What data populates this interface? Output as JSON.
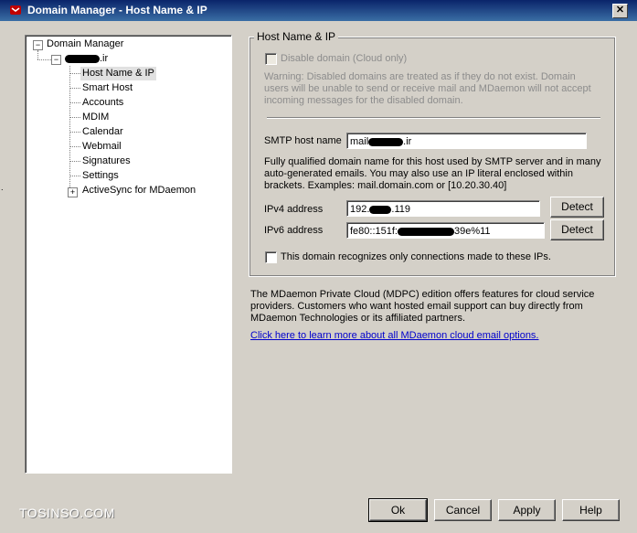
{
  "window": {
    "title": "Domain Manager - Host Name & IP",
    "close_label": "✕"
  },
  "tree": {
    "root": "Domain Manager",
    "domain_suffix": ".ir",
    "items": [
      "Host Name & IP",
      "Smart Host",
      "Accounts",
      "MDIM",
      "Calendar",
      "Webmail",
      "Signatures",
      "Settings",
      "ActiveSync for MDaemon"
    ],
    "selected": "Host Name & IP"
  },
  "host_group": {
    "legend": "Host Name & IP",
    "disable_label": "Disable domain (Cloud only)",
    "warning": "Warning:  Disabled domains are treated as if they do not exist.  Domain users will be unable to send or receive mail and MDaemon will not accept incoming messages for the disabled domain.",
    "smtp_label": "SMTP host name",
    "smtp_prefix": "mail",
    "smtp_suffix": ".ir",
    "fqdn_note": "Fully qualified domain name for this host used by SMTP server and in many auto-generated emails.  You may also use an IP literal enclosed within brackets.  Examples:  mail.domain.com or [10.20.30.40]",
    "ipv4_label": "IPv4 address",
    "ipv4_prefix": "192.",
    "ipv4_suffix": ".119",
    "ipv6_label": "IPv6 address",
    "ipv6_prefix": "fe80::151f:",
    "ipv6_suffix": "39e%11",
    "detect_label": "Detect",
    "recognize_label": "This domain recognizes only connections made to these IPs."
  },
  "cloud": {
    "text": "The MDaemon Private Cloud (MDPC) edition offers features for cloud service providers. Customers who want hosted email support can buy directly from MDaemon Technologies or its affiliated partners.",
    "link": "Click here to learn more about all MDaemon cloud email options."
  },
  "buttons": {
    "ok": "Ok",
    "cancel": "Cancel",
    "apply": "Apply",
    "help": "Help"
  },
  "watermark": "TOSINSO.COM",
  "colors": {
    "title_bar": "#0a246a",
    "face": "#d4d0c8",
    "link": "#0000cc"
  }
}
